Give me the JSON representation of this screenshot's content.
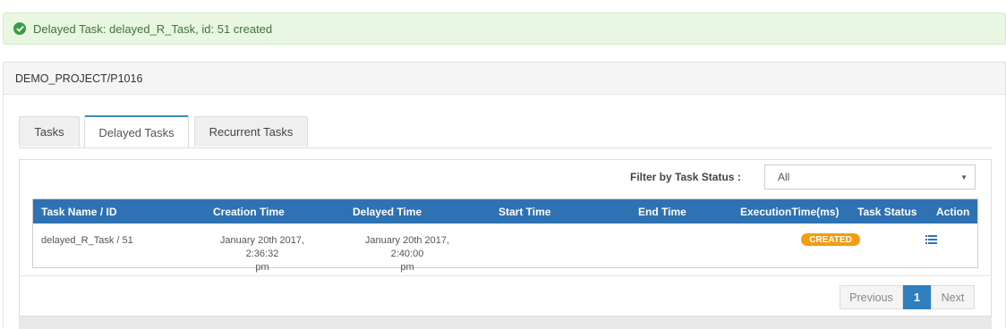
{
  "alert": {
    "message": "Delayed Task: delayed_R_Task, id: 51 created",
    "icon": "check-circle-icon"
  },
  "panel": {
    "title": "DEMO_PROJECT/P1016"
  },
  "tabs": [
    {
      "label": "Tasks",
      "active": false
    },
    {
      "label": "Delayed Tasks",
      "active": true
    },
    {
      "label": "Recurrent Tasks",
      "active": false
    }
  ],
  "filter": {
    "label": "Filter by Task Status :",
    "selected": "All"
  },
  "table": {
    "columns": [
      "Task Name / ID",
      "Creation Time",
      "Delayed Time",
      "Start Time",
      "End Time",
      "ExecutionTime(ms)",
      "Task Status",
      "Action"
    ],
    "rows": [
      {
        "task": "delayed_R_Task / 51",
        "creation_l1": "January 20th 2017, 2:36:32",
        "creation_l2": "pm",
        "delayed_l1": "January 20th 2017, 2:40:00",
        "delayed_l2": "pm",
        "start": "",
        "end": "",
        "execution": "",
        "status": "CREATED",
        "action_icon": "list-icon"
      }
    ]
  },
  "pagination": {
    "previous": "Previous",
    "current": "1",
    "next": "Next"
  },
  "colors": {
    "header": "#2e72b3",
    "badge": "#f39c12",
    "alert_bg": "#e9f6e1",
    "accent": "#3c8dbc"
  }
}
